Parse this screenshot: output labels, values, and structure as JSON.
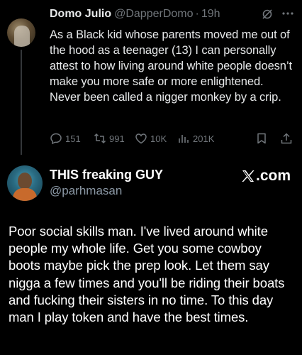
{
  "tweet": {
    "author_name": "Domo Julio",
    "author_handle": "@DapperDomo",
    "separator": "·",
    "time": "19h",
    "text": "As a Black kid whose parents moved me out of the hood as a teenager (13) I can personally attest to how living around white people doesn’t make you more safe or more enlightened. Never been called a nigger monkey by a crip.",
    "actions": {
      "replies": "151",
      "retweets": "991",
      "likes": "10K",
      "views": "201K"
    },
    "icons": {
      "avatar": "profile-photo",
      "grok": "grok-icon",
      "more": "more-dots-icon",
      "reply": "reply-bubble-icon",
      "retweet": "retweet-arrows-icon",
      "like": "heart-icon",
      "views": "bar-chart-icon",
      "bookmark": "bookmark-icon",
      "share": "share-upload-icon"
    }
  },
  "quote": {
    "author_name": "THIS freaking GUY",
    "author_handle": "@parhmasan",
    "brand": ".com",
    "text": "Poor social skills man. I've lived around white people my whole life. Get you some cowboy boots maybe pick the prep look. Let them say nigga a few times and you'll be riding their boats and fucking their sisters in no time. To this day man I play token and have the best times."
  },
  "colors": {
    "background": "#000000",
    "primary_text": "#e7e9ea",
    "secondary_text": "#71767b",
    "thread_line": "#333639"
  }
}
